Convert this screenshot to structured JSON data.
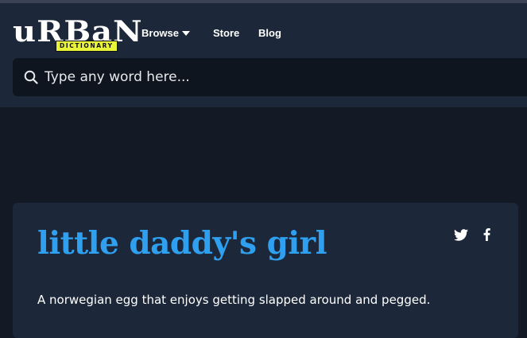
{
  "colors": {
    "background": "#131a26",
    "header": "#1c2839",
    "card": "#1c2839",
    "search_bg": "#0f151f",
    "title_accent": "#2f9ff0",
    "logo_badge": "#e8f43a"
  },
  "logo": {
    "word": "uRBaN",
    "sub": "DICTIONARY"
  },
  "nav": {
    "browse_label": "Browse",
    "store_label": "Store",
    "blog_label": "Blog"
  },
  "search": {
    "placeholder": "Type any word here...",
    "icon": "search-icon"
  },
  "entry": {
    "word": "little daddy's girl",
    "definition": "A norwegian egg that enjoys getting slapped around and pegged.",
    "share_icons": [
      "twitter-icon",
      "facebook-icon"
    ]
  }
}
